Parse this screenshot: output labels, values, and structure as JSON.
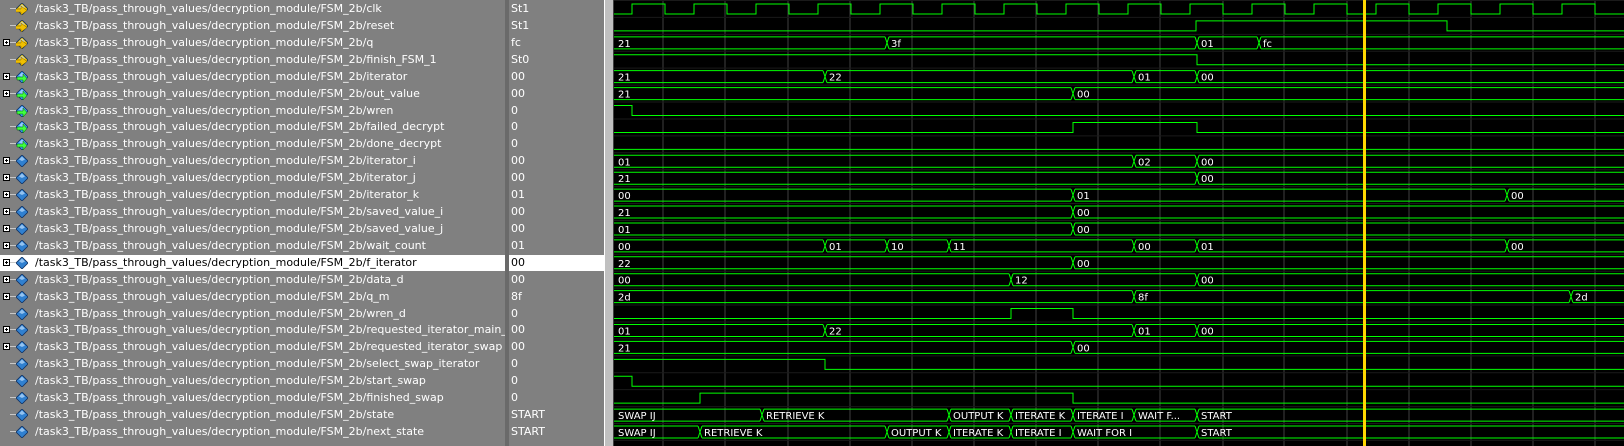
{
  "signals": [
    {
      "name": "/task3_TB/pass_through_values/decryption_module/FSM_2b/clk",
      "value": "St1",
      "expandable": false,
      "kind": "bit",
      "icon": "input"
    },
    {
      "name": "/task3_TB/pass_through_values/decryption_module/FSM_2b/reset",
      "value": "St1",
      "expandable": false,
      "kind": "bit",
      "icon": "input"
    },
    {
      "name": "/task3_TB/pass_through_values/decryption_module/FSM_2b/q",
      "value": "fc",
      "expandable": true,
      "kind": "bus",
      "icon": "input"
    },
    {
      "name": "/task3_TB/pass_through_values/decryption_module/FSM_2b/finish_FSM_1",
      "value": "St0",
      "expandable": false,
      "kind": "bit",
      "icon": "input"
    },
    {
      "name": "/task3_TB/pass_through_values/decryption_module/FSM_2b/iterator",
      "value": "00",
      "expandable": true,
      "kind": "bus",
      "icon": "output"
    },
    {
      "name": "/task3_TB/pass_through_values/decryption_module/FSM_2b/out_value",
      "value": "00",
      "expandable": true,
      "kind": "bus",
      "icon": "output"
    },
    {
      "name": "/task3_TB/pass_through_values/decryption_module/FSM_2b/wren",
      "value": "0",
      "expandable": false,
      "kind": "bit",
      "icon": "output"
    },
    {
      "name": "/task3_TB/pass_through_values/decryption_module/FSM_2b/failed_decrypt",
      "value": "0",
      "expandable": false,
      "kind": "bit",
      "icon": "output"
    },
    {
      "name": "/task3_TB/pass_through_values/decryption_module/FSM_2b/done_decrypt",
      "value": "0",
      "expandable": false,
      "kind": "bit",
      "icon": "output"
    },
    {
      "name": "/task3_TB/pass_through_values/decryption_module/FSM_2b/iterator_i",
      "value": "00",
      "expandable": true,
      "kind": "bus",
      "icon": "internal"
    },
    {
      "name": "/task3_TB/pass_through_values/decryption_module/FSM_2b/iterator_j",
      "value": "00",
      "expandable": true,
      "kind": "bus",
      "icon": "internal"
    },
    {
      "name": "/task3_TB/pass_through_values/decryption_module/FSM_2b/iterator_k",
      "value": "01",
      "expandable": true,
      "kind": "bus",
      "icon": "internal"
    },
    {
      "name": "/task3_TB/pass_through_values/decryption_module/FSM_2b/saved_value_i",
      "value": "00",
      "expandable": true,
      "kind": "bus",
      "icon": "internal"
    },
    {
      "name": "/task3_TB/pass_through_values/decryption_module/FSM_2b/saved_value_j",
      "value": "00",
      "expandable": true,
      "kind": "bus",
      "icon": "internal"
    },
    {
      "name": "/task3_TB/pass_through_values/decryption_module/FSM_2b/wait_count",
      "value": "01",
      "expandable": true,
      "kind": "bus",
      "icon": "internal"
    },
    {
      "name": "/task3_TB/pass_through_values/decryption_module/FSM_2b/f_iterator",
      "value": "00",
      "expandable": true,
      "kind": "bus",
      "icon": "internal",
      "selected": true
    },
    {
      "name": "/task3_TB/pass_through_values/decryption_module/FSM_2b/data_d",
      "value": "00",
      "expandable": true,
      "kind": "bus",
      "icon": "internal"
    },
    {
      "name": "/task3_TB/pass_through_values/decryption_module/FSM_2b/q_m",
      "value": "8f",
      "expandable": true,
      "kind": "bus",
      "icon": "internal"
    },
    {
      "name": "/task3_TB/pass_through_values/decryption_module/FSM_2b/wren_d",
      "value": "0",
      "expandable": false,
      "kind": "bit",
      "icon": "internal"
    },
    {
      "name": "/task3_TB/pass_through_values/decryption_module/FSM_2b/requested_iterator_main_loop",
      "value": "00",
      "expandable": true,
      "kind": "bus",
      "icon": "internal"
    },
    {
      "name": "/task3_TB/pass_through_values/decryption_module/FSM_2b/requested_iterator_swap",
      "value": "00",
      "expandable": true,
      "kind": "bus",
      "icon": "internal"
    },
    {
      "name": "/task3_TB/pass_through_values/decryption_module/FSM_2b/select_swap_iterator",
      "value": "0",
      "expandable": false,
      "kind": "bit",
      "icon": "internal"
    },
    {
      "name": "/task3_TB/pass_through_values/decryption_module/FSM_2b/start_swap",
      "value": "0",
      "expandable": false,
      "kind": "bit",
      "icon": "internal"
    },
    {
      "name": "/task3_TB/pass_through_values/decryption_module/FSM_2b/finished_swap",
      "value": "0",
      "expandable": false,
      "kind": "bit",
      "icon": "internal"
    },
    {
      "name": "/task3_TB/pass_through_values/decryption_module/FSM_2b/state",
      "value": "START",
      "expandable": false,
      "kind": "bus",
      "icon": "internal"
    },
    {
      "name": "/task3_TB/pass_through_values/decryption_module/FSM_2b/next_state",
      "value": "START",
      "expandable": false,
      "kind": "bus",
      "icon": "internal"
    }
  ],
  "wave_labels": [
    [
      "21",
      "3f",
      "01",
      "fc"
    ],
    [
      "21",
      "22",
      "01",
      "00"
    ],
    [
      "21",
      "00"
    ],
    [
      "01",
      "02",
      "00"
    ],
    [
      "21",
      "00"
    ],
    [
      "00",
      "01",
      "00"
    ],
    [
      "21",
      "00"
    ],
    [
      "01",
      "00"
    ],
    [
      "00",
      "01",
      "10",
      "11",
      "00",
      "01",
      "00"
    ],
    [
      "22",
      "00"
    ],
    [
      "00",
      "12",
      "00"
    ],
    [
      "2d",
      "8f",
      "2d"
    ],
    [
      "01",
      "22",
      "01",
      "00"
    ],
    [
      "21",
      "00"
    ],
    [
      "SWAP IJ",
      "RETRIEVE K",
      "OUTPUT K",
      "ITERATE K",
      "ITERATE I",
      "WAIT F...",
      "START"
    ],
    [
      "SWAP IJ",
      "RETRIEVE K",
      "OUTPUT K",
      "ITERATE K",
      "ITERATE I",
      "WAIT FOR I",
      "START"
    ]
  ],
  "colors": {
    "wave": "#00ff00",
    "cursor": "#ffd700",
    "grid": "#404040",
    "selected_row": "#ffffff"
  }
}
